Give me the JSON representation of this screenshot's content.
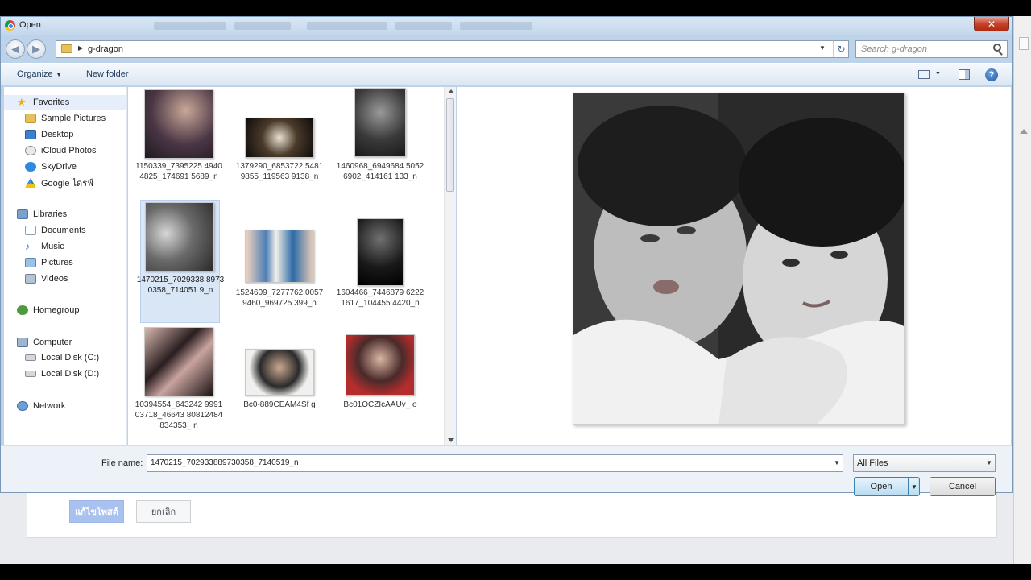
{
  "window": {
    "title": "Open",
    "close_glyph": "✕"
  },
  "address_bar": {
    "path": "g-dragon",
    "search_placeholder": "Search g-dragon",
    "back_glyph": "◀",
    "forward_glyph": "▶",
    "refresh_glyph": "↻"
  },
  "toolbar": {
    "organize_label": "Organize",
    "new_folder_label": "New folder",
    "help_glyph": "?"
  },
  "nav_pane": {
    "items": [
      {
        "label": "Favorites",
        "icon": "star-icon"
      },
      {
        "label": "Sample Pictures",
        "icon": "folder-icon"
      },
      {
        "label": "Desktop",
        "icon": "desktop-icon"
      },
      {
        "label": "iCloud Photos",
        "icon": "icloud-icon"
      },
      {
        "label": "SkyDrive",
        "icon": "skydrive-icon"
      },
      {
        "label": "Google ไดรฟ์",
        "icon": "google-drive-icon"
      },
      {
        "label": "Libraries",
        "icon": "libraries-icon"
      },
      {
        "label": "Documents",
        "icon": "documents-icon"
      },
      {
        "label": "Music",
        "icon": "music-icon"
      },
      {
        "label": "Pictures",
        "icon": "pictures-icon"
      },
      {
        "label": "Videos",
        "icon": "videos-icon"
      },
      {
        "label": "Homegroup",
        "icon": "homegroup-icon"
      },
      {
        "label": "Computer",
        "icon": "computer-icon"
      },
      {
        "label": "Local Disk (C:)",
        "icon": "disk-icon"
      },
      {
        "label": "Local Disk (D:)",
        "icon": "disk-icon"
      },
      {
        "label": "Network",
        "icon": "network-icon"
      }
    ]
  },
  "files": [
    {
      "name": "1150339_7395225 49404825_174691 5689_n",
      "selected": false
    },
    {
      "name": "1379290_6853722 54819855_119563 9138_n",
      "selected": false
    },
    {
      "name": "1460968_6949684 50526902_414161 133_n",
      "selected": false
    },
    {
      "name": "1470215_7029338 89730358_714051 9_n",
      "selected": true
    },
    {
      "name": "1524609_7277762 00579460_969725 399_n",
      "selected": false
    },
    {
      "name": "1604466_7446879 62221617_104455 4420_n",
      "selected": false
    },
    {
      "name": "10394554_643242 999103718_46643 80812484834353_ n",
      "selected": false
    },
    {
      "name": "Bc0-889CEAM4Sf g",
      "selected": false
    },
    {
      "name": "Bc01OCZIcAAUv_ o",
      "selected": false
    }
  ],
  "bottom": {
    "file_name_label": "File name:",
    "file_name_value": "1470215_702933889730358_7140519_n",
    "file_type": "All Files",
    "open_label": "Open",
    "cancel_label": "Cancel"
  },
  "webpage": {
    "primary_button": "แก้ไขโพสต์",
    "cancel_button": "ยกเลิก"
  }
}
